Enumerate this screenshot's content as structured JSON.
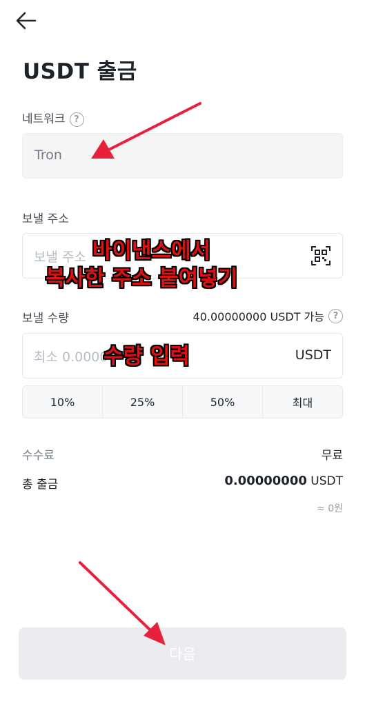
{
  "header": {
    "title": "USDT 출금"
  },
  "network": {
    "label": "네트워크",
    "value": "Tron"
  },
  "address": {
    "label": "보낼 주소",
    "placeholder": "보낼 주소"
  },
  "amount": {
    "label": "보낼 수량",
    "available": "40.00000000 USDT 가능",
    "placeholder": "최소 0.0000",
    "unit": "USDT"
  },
  "percent_buttons": [
    "10%",
    "25%",
    "50%",
    "최대"
  ],
  "fee": {
    "label": "수수료",
    "value": "무료"
  },
  "total": {
    "label": "총 출금",
    "value": "0.00000000",
    "unit": "USDT",
    "krw": "≈ 0원"
  },
  "next_button": "다음",
  "annotations": {
    "address_line1": "바이낸스에서",
    "address_line2": "복사한 주소 붙여넣기",
    "amount": "수량 입력"
  },
  "icons": {
    "back": "back-arrow-icon",
    "help": "help-icon",
    "qr": "qr-scan-icon"
  },
  "colors": {
    "annotation": "#e01010",
    "arrow": "#e8203c",
    "disabled_button": "#eaecef"
  }
}
